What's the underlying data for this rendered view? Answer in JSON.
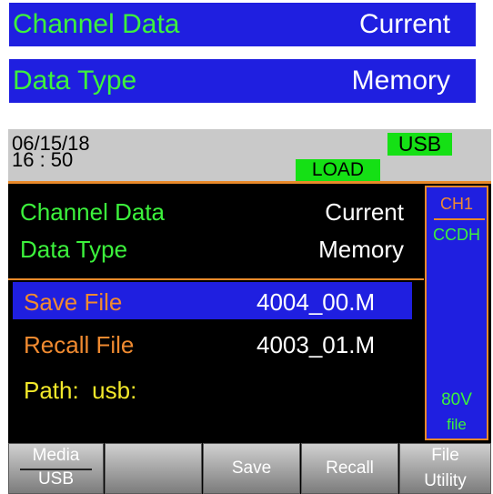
{
  "callouts": [
    {
      "label": "Channel Data",
      "value": "Current"
    },
    {
      "label": "Data Type",
      "value": "Memory"
    }
  ],
  "status": {
    "date": "06/15/18",
    "time": "16 : 50",
    "usb": "USB",
    "load": "LOAD"
  },
  "info": {
    "channel_data_label": "Channel Data",
    "channel_data_value": "Current",
    "data_type_label": "Data Type",
    "data_type_value": "Memory"
  },
  "files": {
    "save_label": "Save File",
    "save_value": "4004_00.M",
    "recall_label": "Recall File",
    "recall_value": "4003_01.M",
    "path_label": "Path:",
    "path_value": "usb:"
  },
  "side": {
    "channel": "CH1",
    "mode": "CCDH",
    "voltage": "80V",
    "file": "file"
  },
  "keys": {
    "media_top": "Media",
    "media_bottom": "USB",
    "blank": "",
    "save": "Save",
    "recall": "Recall",
    "file_utility_top": "File",
    "file_utility_bottom": "Utility"
  },
  "colors": {
    "accent_green": "#3cf23c",
    "highlight_blue": "#1f1fe0",
    "orange": "#e8892a",
    "yellow": "#f2e82a",
    "badge_green": "#15e015"
  }
}
